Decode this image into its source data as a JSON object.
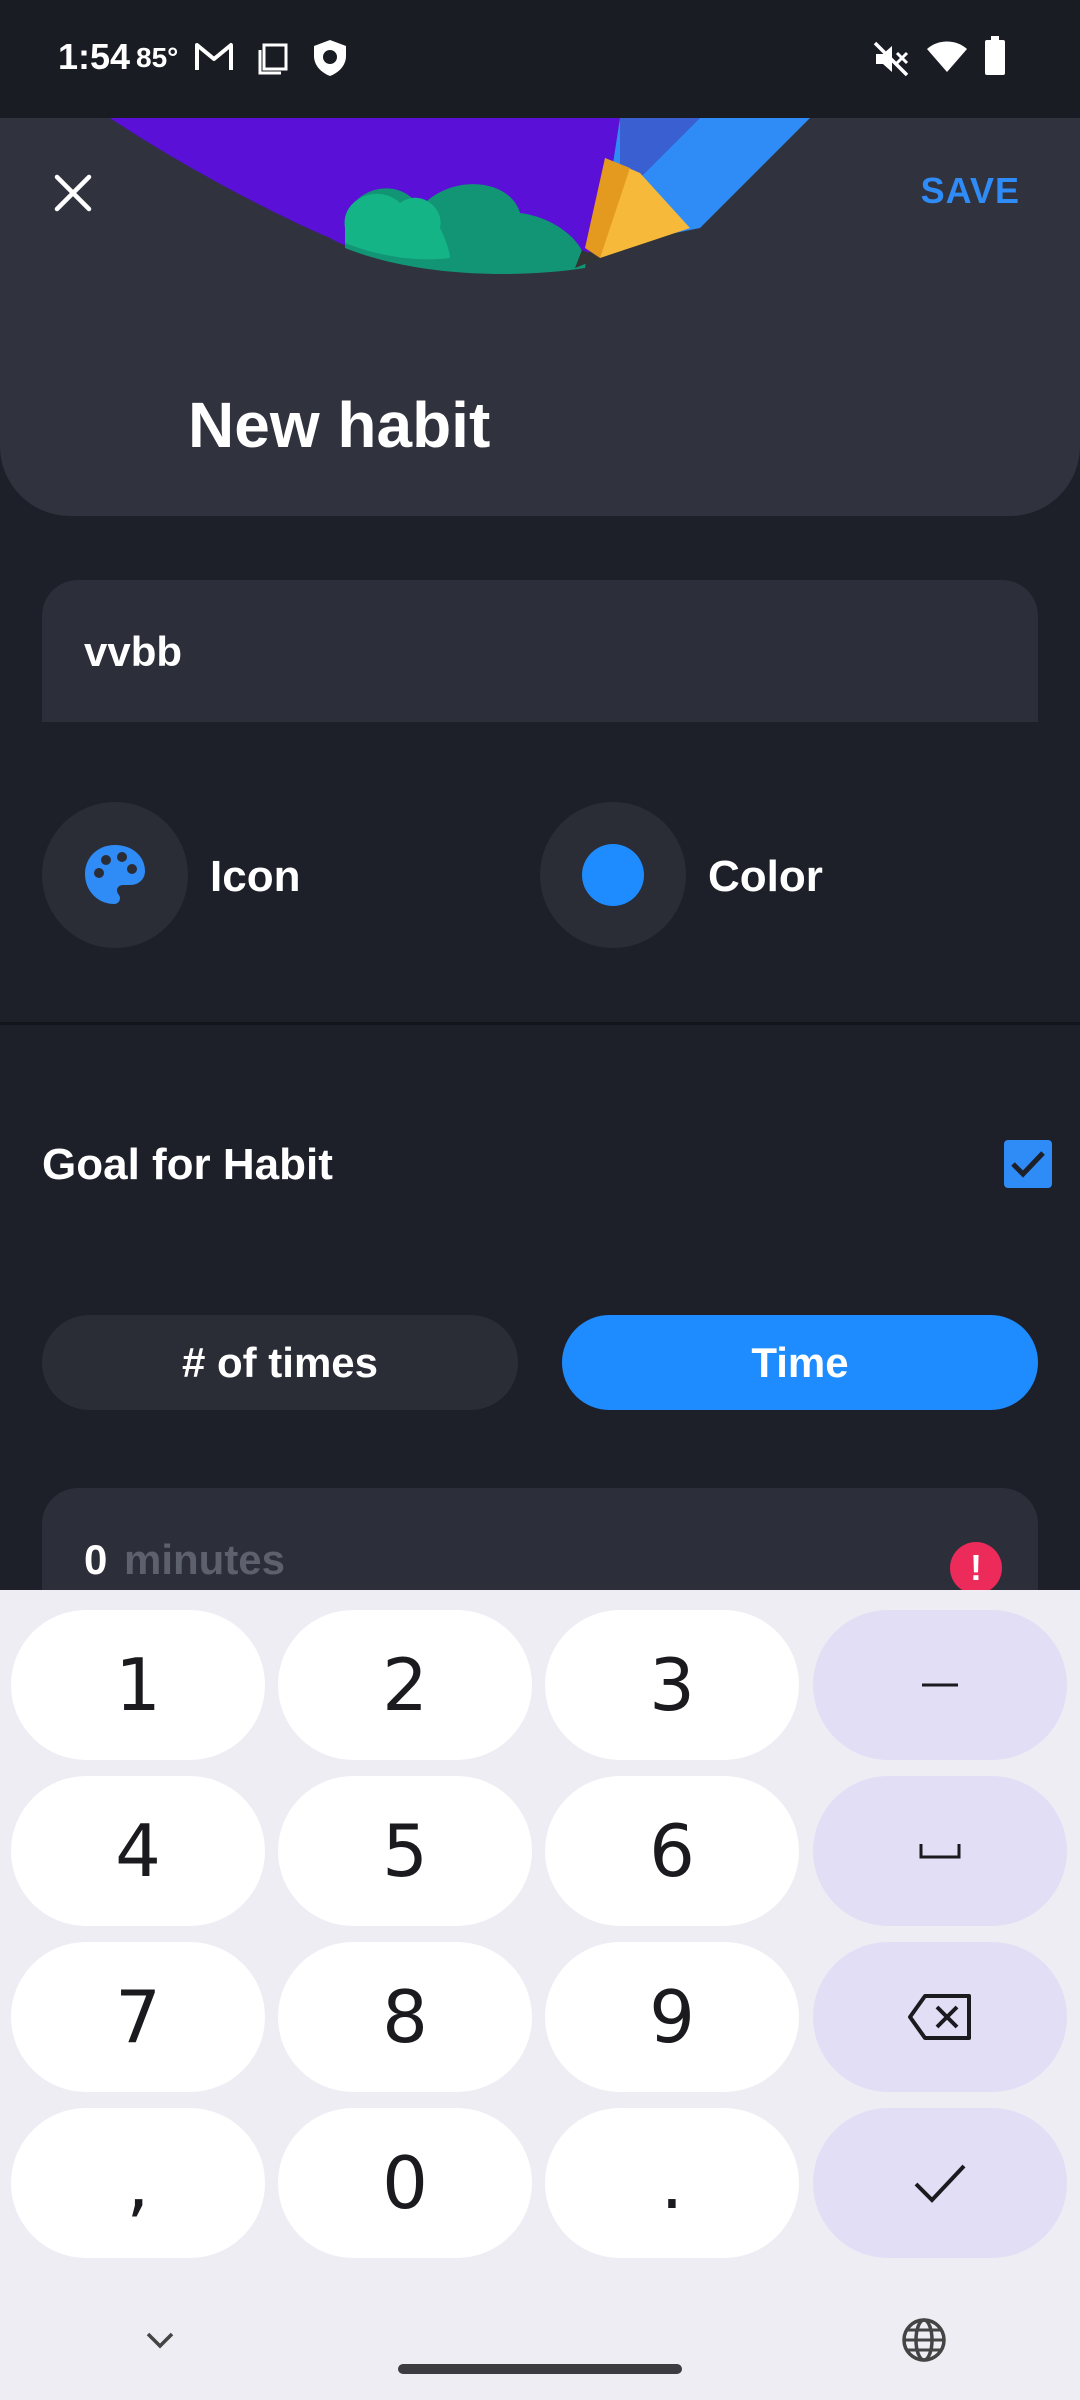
{
  "status_bar": {
    "time": "1:54",
    "temperature": "85°",
    "icons": [
      "gmail-icon",
      "screenshot-icon",
      "shield-icon",
      "mute-icon",
      "wifi-icon",
      "battery-icon"
    ]
  },
  "header": {
    "title": "New habit",
    "save_label": "SAVE",
    "close_icon": "close-icon"
  },
  "form": {
    "name_value": "vvbb",
    "icon_label": "Icon",
    "color_label": "Color",
    "selected_color": "#1e8cff",
    "goal_label": "Goal for Habit",
    "goal_checked": true,
    "goal_type_options": [
      "# of times",
      "Time"
    ],
    "goal_type_selected": "Time",
    "minutes_value": "0",
    "minutes_unit": "minutes",
    "error_symbol": "!"
  },
  "keyboard": {
    "rows": [
      [
        "1",
        "2",
        "3",
        "–"
      ],
      [
        "4",
        "5",
        "6",
        "␣"
      ],
      [
        "7",
        "8",
        "9",
        "⌫"
      ],
      [
        ",",
        "0",
        ".",
        "✓"
      ]
    ],
    "function_icons": [
      "minus-icon",
      "space-icon",
      "backspace-icon",
      "done-check-icon"
    ],
    "hide_icon": "chevron-down-icon",
    "language_icon": "globe-icon"
  },
  "colors": {
    "accent": "#2f8bf5",
    "selected_segment": "#1e8cff",
    "error": "#ec2b5a",
    "background": "#1e2029"
  }
}
